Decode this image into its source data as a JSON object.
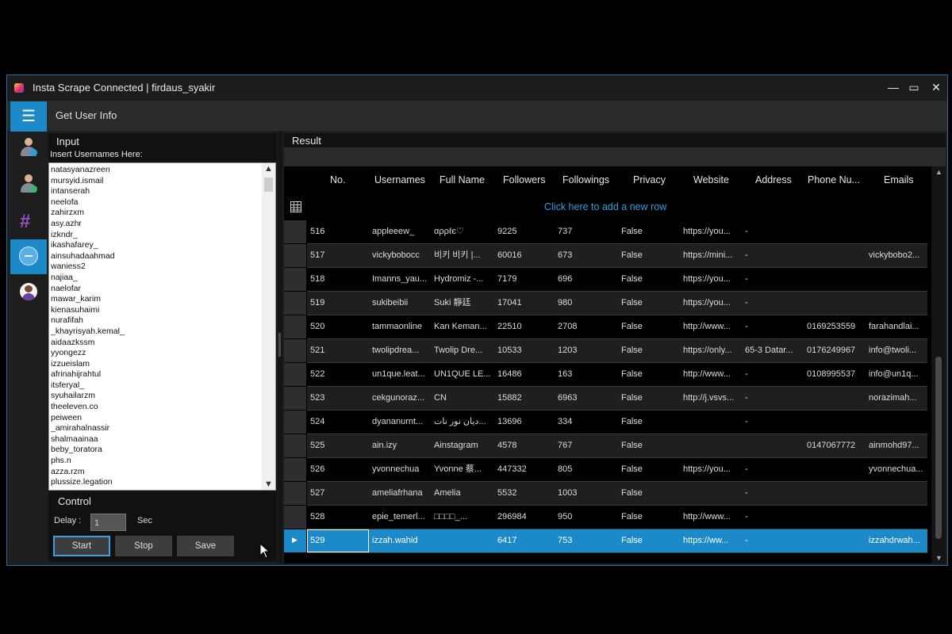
{
  "window": {
    "title": "Insta Scrape Connected | firdaus_syakir",
    "menu_title": "Get User Info",
    "menu_glyph": "☰",
    "minimize": "—",
    "maximize": "▭",
    "close": "✕"
  },
  "sidebar": {
    "items": [
      {
        "icon": "user-settings-icon"
      },
      {
        "icon": "user-info-icon"
      },
      {
        "icon": "hashtag-icon"
      },
      {
        "icon": "globe-icon",
        "active": true
      },
      {
        "icon": "avatar-icon"
      }
    ]
  },
  "input": {
    "label": "Input",
    "sublabel": "Insert Usernames Here:",
    "usernames": [
      "natasyanazreen",
      "mursyid.ismail",
      "intanserah",
      "neelofa",
      "zahirzxm",
      "asy.azhr",
      "izkndr_",
      "ikashafarey_",
      "ainsuhadaahmad",
      "waniess2",
      "najiaa_",
      "naelofar",
      "mawar_karim",
      "kienasuhaimi",
      "nurafifah",
      "_khayrisyah.kemal_",
      "aidaazkssm",
      "yyongezz",
      "izzueislam",
      "afrinahijrahtul",
      "itsferyal_",
      "syuhailarzm",
      "theeleven.co",
      "peiween",
      "_amirahalnassir",
      "shalmaainaa",
      "beby_toratora",
      "phs.n",
      "azza.rzm",
      "plussize.legation"
    ],
    "scroll_up": "▲",
    "scroll_down": "▼"
  },
  "control": {
    "label": "Control",
    "delay_label": "Delay :",
    "delay_value": "1",
    "sec_label": "Sec",
    "start": "Start",
    "stop": "Stop",
    "save": "Save"
  },
  "result": {
    "label": "Result",
    "columns": [
      "No.",
      "Usernames",
      "Full Name",
      "Followers",
      "Followings",
      "Privacy",
      "Website",
      "Address",
      "Phone Nu...",
      "Emails"
    ],
    "new_row_text": "Click here to add a new row",
    "selected_marker": "▶",
    "rows": [
      [
        "516",
        "appleeew_",
        "αρρℓє♡",
        "9225",
        "737",
        "False",
        "https://you...",
        "-",
        "",
        ""
      ],
      [
        "517",
        "vickybobocc",
        "비키 비키 |...",
        "60016",
        "673",
        "False",
        "https://mini...",
        "-",
        "",
        "vickybobo2..."
      ],
      [
        "518",
        "Imanns_yau...",
        "Hydromiz -...",
        "7179",
        "696",
        "False",
        "https://you...",
        "-",
        "",
        ""
      ],
      [
        "519",
        "sukibeibii",
        "Suki 靜廷",
        "17041",
        "980",
        "False",
        "https://you...",
        "-",
        "",
        ""
      ],
      [
        "520",
        "tammaonline",
        "Kan Keman...",
        "22510",
        "2708",
        "False",
        "http://www...",
        "-",
        "0169253559",
        "farahandlai..."
      ],
      [
        "521",
        "twolipdrea...",
        "Twolip Dre...",
        "10533",
        "1203",
        "False",
        "https://only...",
        "65-3 Datar...",
        "0176249967",
        "info@twoli..."
      ],
      [
        "522",
        "un1que.leat...",
        "UN1QUE LE...",
        "16486",
        "163",
        "False",
        "http://www...",
        "-",
        "0108995537",
        "info@un1q..."
      ],
      [
        "523",
        "cekgunoraz...",
        "CN",
        "15882",
        "6963",
        "False",
        "http://j.vsvs...",
        "-",
        "",
        "norazimah..."
      ],
      [
        "524",
        "dyananurnt...",
        "دیان نور نات...",
        "13696",
        "334",
        "False",
        "",
        "-",
        "",
        ""
      ],
      [
        "525",
        "ain.izy",
        "Ainstagram",
        "4578",
        "767",
        "False",
        "",
        "",
        "0147067772",
        "ainmohd97..."
      ],
      [
        "526",
        "yvonnechua",
        "Yvonne 蔡...",
        "447332",
        "805",
        "False",
        "https://you...",
        "-",
        "",
        "yvonnechua..."
      ],
      [
        "527",
        "ameliafrhana",
        "Amelia",
        "5532",
        "1003",
        "False",
        "",
        "-",
        "",
        ""
      ],
      [
        "528",
        "epie_temerl...",
        "□□□□_...",
        "296984",
        "950",
        "False",
        "http://www...",
        "-",
        "",
        ""
      ],
      [
        "529",
        "izzah.wahid",
        "",
        "6417",
        "753",
        "False",
        "https://ww...",
        "-",
        "",
        "izzahdrwah..."
      ]
    ]
  },
  "colors": {
    "accent": "#1c8ac8",
    "link": "#2b9ee0"
  }
}
